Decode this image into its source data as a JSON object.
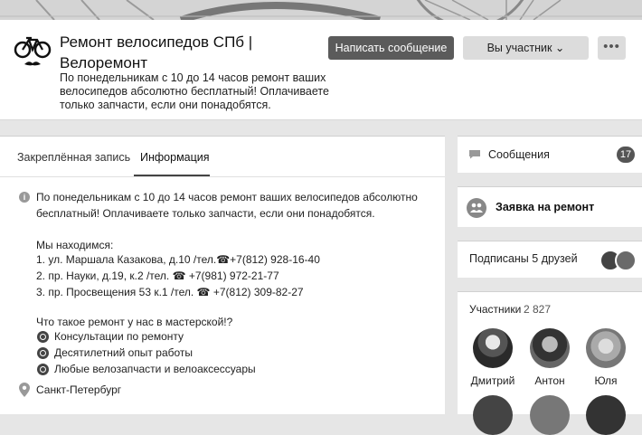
{
  "group": {
    "title": "Ремонт велосипедов СПб | Велоремонт",
    "status": "По понедельникам с 10 до 14 часов ремонт ваших велосипедов абсолютно бесплатный! Оплачиваете только запчасти, если они понадобятся."
  },
  "actions": {
    "send_message": "Написать сообщение",
    "membership": "Вы участник ⌄",
    "more": "•••"
  },
  "tabs": {
    "pinned": "Закреплённая запись",
    "info": "Информация"
  },
  "info": {
    "line1": "По понедельникам с 10 до 14 часов ремонт ваших велосипедов абсолютно",
    "line2": "бесплатный! Оплачиваете только запчасти, если они понадобятся.",
    "located": "Мы находимся:",
    "address1": "1. ул. Маршала Казакова, д.10 /тел.☎+7(812) 928-16-40",
    "address2": "2. пр. Науки, д.19, к.2 /тел. ☎ +7(981) 972-21-77",
    "address3": "3. пр. Просвещения 53 к.1 /тел. ☎ +7(812) 309-82-27",
    "question": "Что такое ремонт у нас в мастерской!?",
    "features": [
      "Консультации по ремонту",
      "Десятилетний опыт работы",
      "Любые велозапчасти и велоаксессуары"
    ],
    "city": "Санкт-Петербург"
  },
  "sidebar": {
    "messages_label": "Сообщения",
    "messages_count": "17",
    "request_label": "Заявка на ремонт",
    "friends_label": "Подписаны 5 друзей",
    "members_label": "Участники",
    "members_count": "2 827",
    "members": [
      {
        "name": "Дмитрий"
      },
      {
        "name": "Антон"
      },
      {
        "name": "Юля"
      }
    ]
  }
}
